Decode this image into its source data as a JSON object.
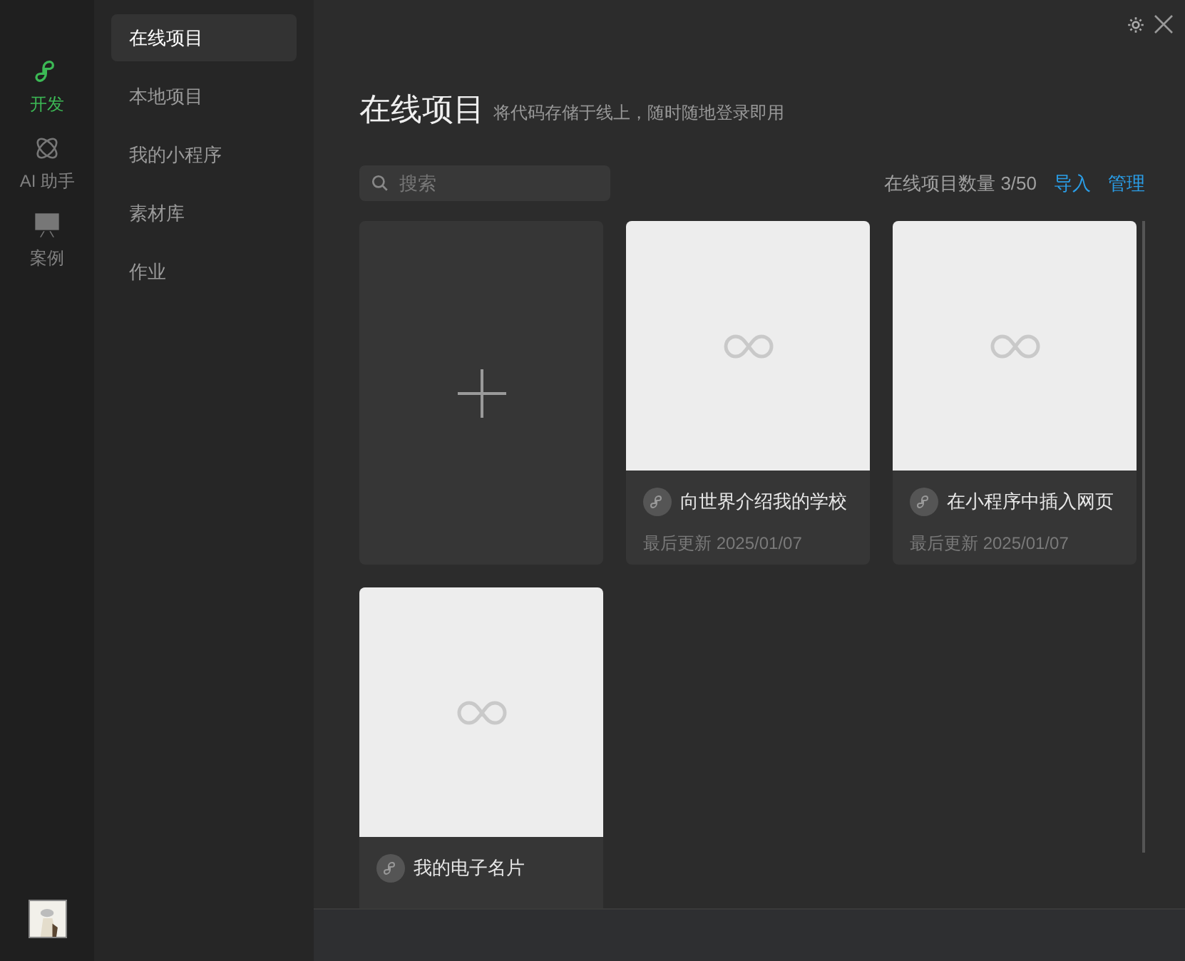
{
  "rail": [
    {
      "label": "开发",
      "kind": "link",
      "selected": true
    },
    {
      "label": "AI 助手",
      "kind": "atom",
      "selected": false
    },
    {
      "label": "案例",
      "kind": "easel",
      "selected": false
    }
  ],
  "sidebar": {
    "items": [
      {
        "label": "在线项目",
        "selected": true
      },
      {
        "label": "本地项目",
        "selected": false
      },
      {
        "label": "我的小程序",
        "selected": false
      },
      {
        "label": "素材库",
        "selected": false
      },
      {
        "label": "作业",
        "selected": false
      }
    ]
  },
  "header": {
    "title": "在线项目",
    "subtitle": "将代码存储于线上，随时随地登录即用"
  },
  "search": {
    "placeholder": "搜索"
  },
  "count": "在线项目数量 3/50",
  "actions": [
    "导入",
    "管理"
  ],
  "projects": [
    {
      "kind": "new"
    },
    {
      "kind": "project",
      "name": "向世界介绍我的学校",
      "updated": "最后更新 2025/01/07"
    },
    {
      "kind": "project",
      "name": "在小程序中插入网页",
      "updated": "最后更新 2025/01/07"
    },
    {
      "kind": "project",
      "name": "我的电子名片"
    }
  ]
}
